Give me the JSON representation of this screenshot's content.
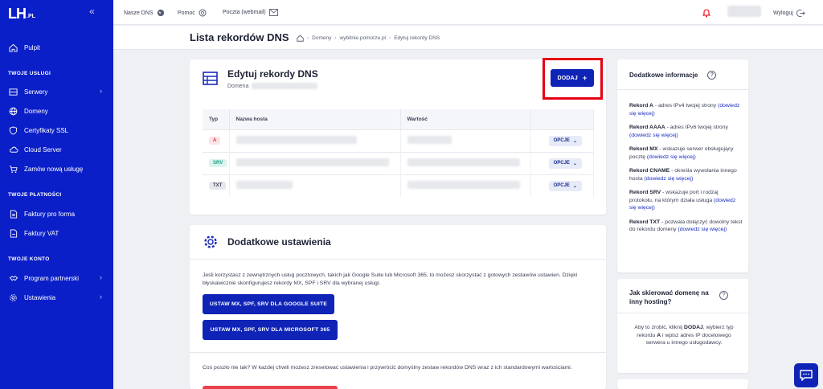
{
  "logo": {
    "main": "LH",
    "sub": ".PL"
  },
  "sidebar": {
    "items": [
      {
        "label": "Pulpit"
      },
      {
        "label": "Serwery"
      },
      {
        "label": "Domeny"
      },
      {
        "label": "Certyfikaty SSL"
      },
      {
        "label": "Cloud Server"
      },
      {
        "label": "Zamów nową usługę"
      },
      {
        "label": "Faktury pro forma"
      },
      {
        "label": "Faktury VAT"
      },
      {
        "label": "Program partnerski"
      },
      {
        "label": "Ustawienia"
      }
    ],
    "sections": {
      "services": "TWOJE USŁUGI",
      "payments": "TWOJE PŁATNOŚCI",
      "account": "TWOJE KONTO"
    }
  },
  "topbar": {
    "dns": "Nasze DNS",
    "help": "Pomoc",
    "mail": "Poczta (webmail)",
    "logout": "Wyloguj"
  },
  "page": {
    "title": "Lista rekordów DNS"
  },
  "breadcrumb": {
    "domains": "Domeny",
    "domain": "wybitnie.pomorze.pl",
    "current": "Edytuj rekordy DNS"
  },
  "editor": {
    "title": "Edytuj rekordy DNS",
    "domain_label": "Domena",
    "add_button": "DODAJ",
    "columns": {
      "type": "Typ",
      "host": "Nazwa hosta",
      "value": "Wartość"
    },
    "rows": [
      {
        "type": "A",
        "options": "OPCJE"
      },
      {
        "type": "SRV",
        "options": "OPCJE"
      },
      {
        "type": "TXT",
        "options": "OPCJE"
      }
    ]
  },
  "settings": {
    "title": "Dodatkowe ustawienia",
    "description": "Jeśli korzystasz z zewnętrznych usług pocztowych, takich jak Google Suite lub Microsoft 365, to możesz skorzystać z gotowych zestawów ustawien. Dzięki błyskawicznie skonfigurujesz rekordy MX, SPF i SRV dla wybranej usługi.",
    "google_button": "USTAW MX, SPF, SRV DLA GOOGLE SUITE",
    "microsoft_button": "USTAW MX, SPF, SRV DLA MICROSOFT 365",
    "reset_text": "Coś poszło nie tak? W każdej chwili możesz zresetować ustawienia i przywrócić domyślny zestaw rekordów DNS wraz z ich standardowymi wartościami."
  },
  "info": {
    "title": "Dodatkowe informacje",
    "more": "(dowiedz się więcej)",
    "records": [
      {
        "name": "Rekord A",
        "desc": " - adres IPv4 twojej strony "
      },
      {
        "name": "Rekord AAAA",
        "desc": " - adres IPv6 twojej strony "
      },
      {
        "name": "Rekord MX",
        "desc": " - wskazuje serwer obsługujący pocztę "
      },
      {
        "name": "Rekord CNAME",
        "desc": " - określa wywołania innego hosta "
      },
      {
        "name": "Rekord SRV",
        "desc": " - wskazuje port i rodzaj protokołu, na którym działa usługa "
      },
      {
        "name": "Rekord TXT",
        "desc": " - pozwala dołączyć dowolny tekst do rekordu domeny "
      }
    ]
  },
  "hosting": {
    "title": "Jak skierować domenę na inny hosting?",
    "t1": "Aby to zrobić, kliknij ",
    "b1": "DODAJ",
    "t2": ", wybierz typ rekordu ",
    "b2": "A",
    "t3": " i wpisz adres IP docelowego serwera u innego usługodawcy."
  },
  "colors": {
    "sidebar": "#0a1fc7",
    "primary": "#0f24b7",
    "highlight": "#e60012",
    "reset": "#e8414b"
  }
}
